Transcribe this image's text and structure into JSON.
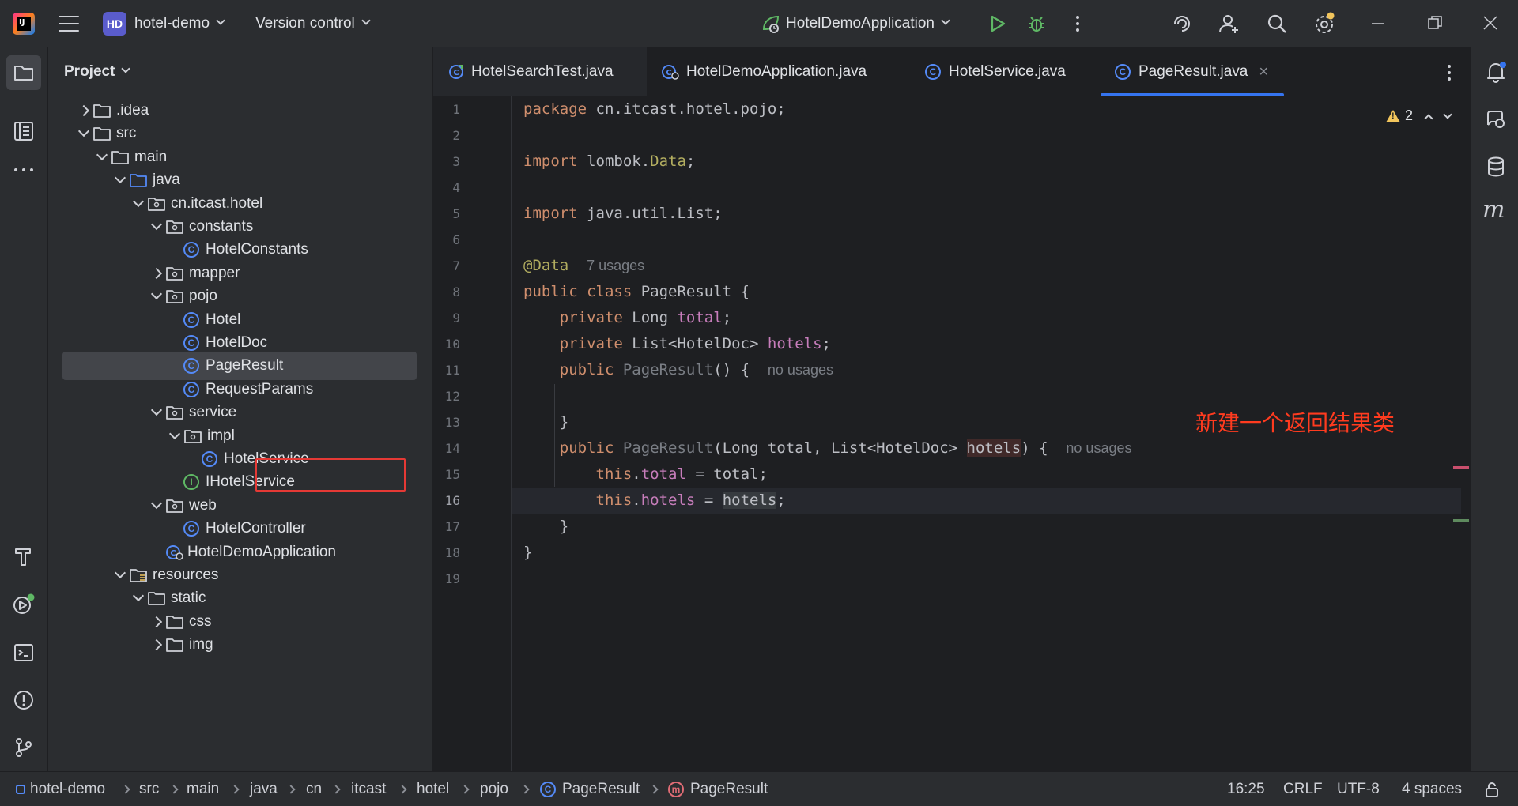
{
  "titlebar": {
    "logo_text": "IJ",
    "project_badge": "HD",
    "project_name": "hotel-demo",
    "version_control": "Version control",
    "run_config": "HotelDemoApplication"
  },
  "project_panel": {
    "title": "Project",
    "tree": [
      {
        "label": ".idea",
        "type": "folder",
        "expanded": false
      },
      {
        "label": "src",
        "type": "folder",
        "expanded": true
      },
      {
        "label": "main",
        "type": "folder",
        "expanded": true
      },
      {
        "label": "java",
        "type": "source-folder",
        "expanded": true
      },
      {
        "label": "cn.itcast.hotel",
        "type": "package",
        "expanded": true
      },
      {
        "label": "constants",
        "type": "package",
        "expanded": true
      },
      {
        "label": "HotelConstants",
        "type": "class"
      },
      {
        "label": "mapper",
        "type": "package",
        "expanded": false
      },
      {
        "label": "pojo",
        "type": "package",
        "expanded": true
      },
      {
        "label": "Hotel",
        "type": "class"
      },
      {
        "label": "HotelDoc",
        "type": "class"
      },
      {
        "label": "PageResult",
        "type": "class",
        "selected": true
      },
      {
        "label": "RequestParams",
        "type": "class"
      },
      {
        "label": "service",
        "type": "package",
        "expanded": true
      },
      {
        "label": "impl",
        "type": "package",
        "expanded": true
      },
      {
        "label": "HotelService",
        "type": "class"
      },
      {
        "label": "IHotelService",
        "type": "interface"
      },
      {
        "label": "web",
        "type": "package",
        "expanded": true
      },
      {
        "label": "HotelController",
        "type": "class"
      },
      {
        "label": "HotelDemoApplication",
        "type": "spring-class"
      },
      {
        "label": "resources",
        "type": "resources-folder",
        "expanded": true
      },
      {
        "label": "static",
        "type": "folder",
        "expanded": true
      },
      {
        "label": "css",
        "type": "folder",
        "expanded": false
      },
      {
        "label": "img",
        "type": "folder",
        "expanded": false
      }
    ]
  },
  "tabs": [
    {
      "label": "HotelSearchTest.java",
      "icon": "test-class-icon"
    },
    {
      "label": "HotelDemoApplication.java",
      "icon": "spring-class-icon"
    },
    {
      "label": "HotelService.java",
      "icon": "class-icon"
    },
    {
      "label": "PageResult.java",
      "icon": "class-icon",
      "active": true
    }
  ],
  "editor": {
    "warnings_count": "2",
    "line_numbers": [
      "1",
      "2",
      "3",
      "4",
      "5",
      "6",
      "7",
      "8",
      "9",
      "10",
      "11",
      "12",
      "13",
      "14",
      "15",
      "16",
      "17",
      "18",
      "19"
    ],
    "current_line": "16",
    "code": {
      "l1_kw": "package",
      "l1_rest": " cn.itcast.hotel.pojo;",
      "l3_kw": "import",
      "l3_pkg": " lombok.",
      "l3_ann": "Data",
      "l3_end": ";",
      "l5_kw": "import",
      "l5_rest": " java.util.List;",
      "l7_ann": "@Data",
      "l7_hint": "7 usages",
      "l8_kw": "public class",
      "l8_rest": " PageResult {",
      "l9_kw": "private",
      "l9_type": " Long ",
      "l9_fld": "total",
      "l9_end": ";",
      "l10_kw": "private",
      "l10_type": " List<HotelDoc> ",
      "l10_fld": "hotels",
      "l10_end": ";",
      "l11_kw": "public",
      "l11_name": " PageResult",
      "l11_rest": "() {",
      "l11_hint": "no usages",
      "l13_brace": "}",
      "l14_kw": "public",
      "l14_name": " PageResult",
      "l14_params": "(Long total, List<HotelDoc> ",
      "l14_hl": "hotels",
      "l14_end": ") {",
      "l14_hint": "no usages",
      "l15_this": "this",
      "l15_dot": ".",
      "l15_fld": "total",
      "l15_rest": " = total;",
      "l16_this": "this",
      "l16_dot": ".",
      "l16_fld": "hotels",
      "l16_eq": " = ",
      "l16_hl": "hotels",
      "l16_end": ";",
      "l17_brace": "}",
      "l18_brace": "}"
    },
    "annotation": "新建一个返回结果类"
  },
  "statusbar": {
    "crumbs": [
      "hotel-demo",
      "src",
      "main",
      "java",
      "cn",
      "itcast",
      "hotel",
      "pojo",
      "PageResult",
      "PageResult"
    ],
    "position": "16:25",
    "line_sep": "CRLF",
    "encoding": "UTF-8",
    "indent": "4 spaces"
  },
  "colors": {
    "accent": "#3574f0",
    "keyword": "#cf8e6d",
    "field": "#c77dbb",
    "annotation": "#b3ae60",
    "red_box": "#e53935"
  }
}
